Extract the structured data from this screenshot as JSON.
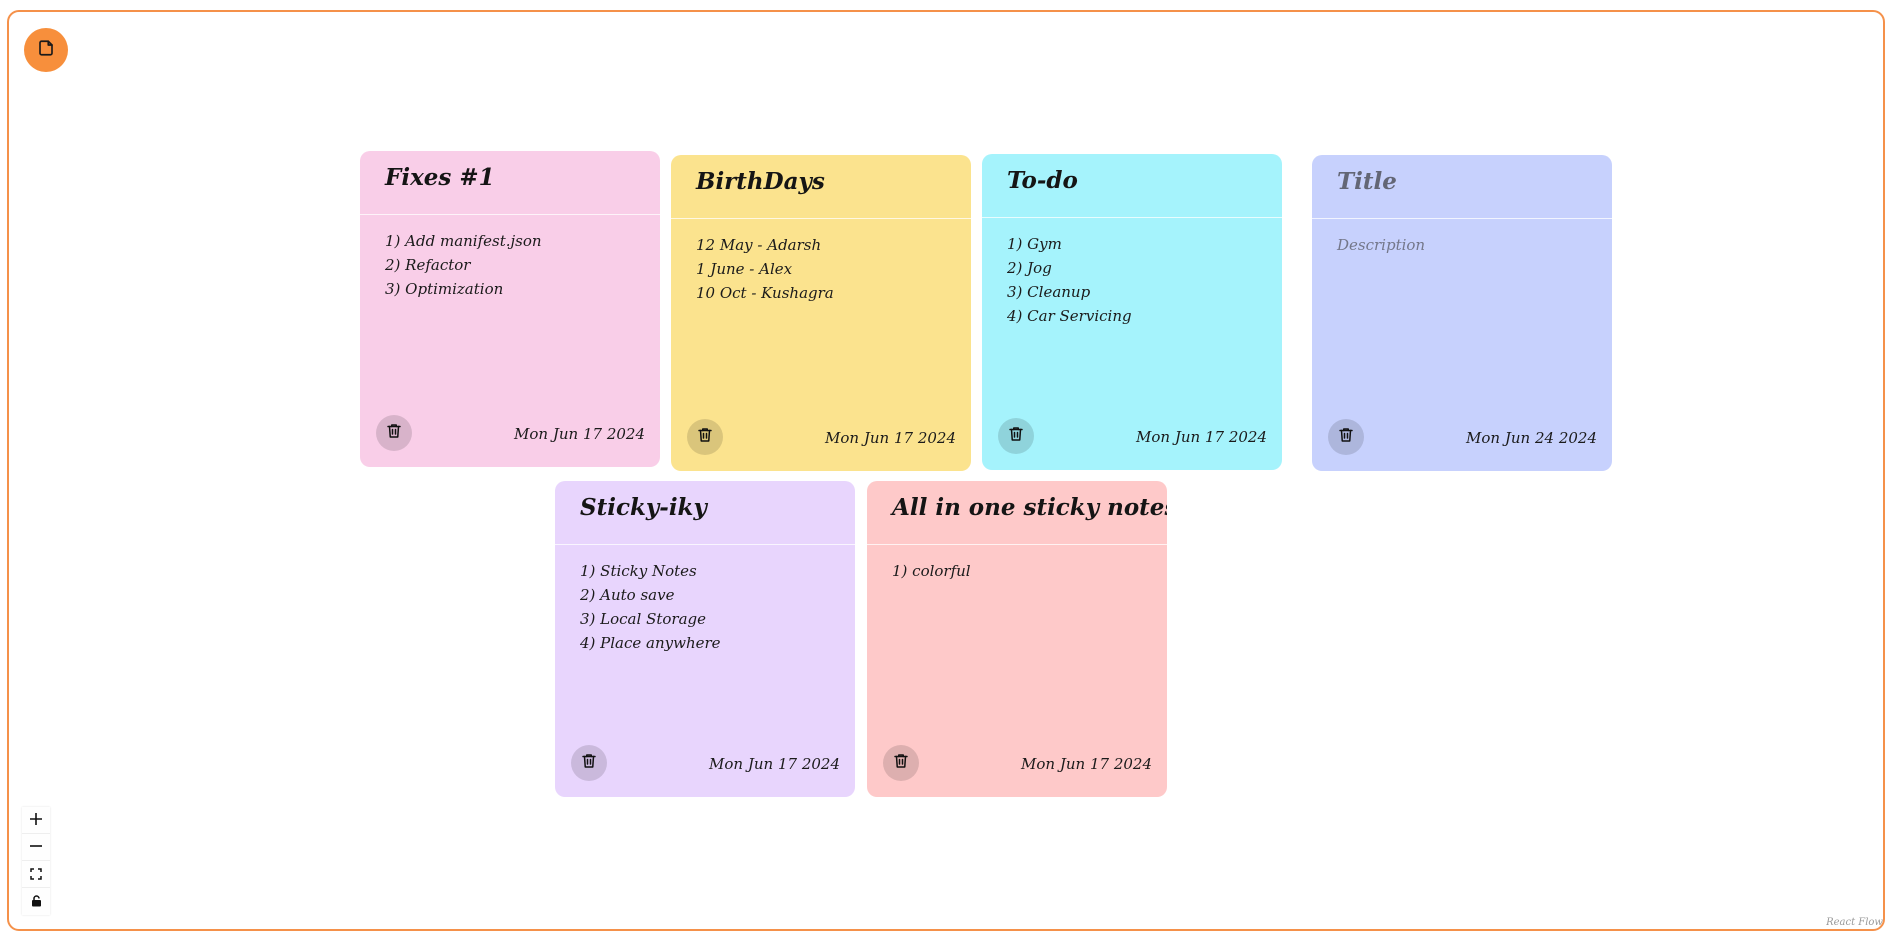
{
  "app": {
    "accent_color": "#f78f3c",
    "add_icon": "note-icon"
  },
  "notes": [
    {
      "title": "Fixes #1",
      "lines": [
        "1) Add manifest.json",
        "2) Refactor",
        "3) Optimization"
      ],
      "date": "Mon Jun 17 2024",
      "color": "#f9cee8"
    },
    {
      "title": "BirthDays",
      "lines": [
        "12 May - Adarsh",
        "1 June - Alex",
        "10 Oct - Kushagra"
      ],
      "date": "Mon Jun 17 2024",
      "color": "#fbe38e"
    },
    {
      "title": "To-do",
      "lines": [
        "1) Gym",
        "2) Jog",
        "3) Cleanup",
        "4) Car Servicing"
      ],
      "date": "Mon Jun 17 2024",
      "color": "#a5f3fc"
    },
    {
      "title_placeholder": "Title",
      "description_placeholder": "Description",
      "date": "Mon Jun 24 2024",
      "color": "#c7d1fd"
    },
    {
      "title": "Sticky-iky",
      "lines": [
        "1) Sticky Notes",
        "2) Auto save",
        "3) Local Storage",
        "4) Place anywhere"
      ],
      "date": "Mon Jun 17 2024",
      "color": "#e8d5fd"
    },
    {
      "title": "All in one sticky notes",
      "lines": [
        "1) colorful"
      ],
      "date": "Mon Jun 17 2024",
      "color": "#fec9c9"
    }
  ],
  "controls": {
    "items": [
      {
        "name": "zoom-in",
        "icon": "plus-icon"
      },
      {
        "name": "zoom-out",
        "icon": "minus-icon"
      },
      {
        "name": "fit-view",
        "icon": "fullscreen-icon"
      },
      {
        "name": "toggle-interactivity",
        "icon": "lock-icon"
      }
    ]
  },
  "attribution": "React Flow"
}
